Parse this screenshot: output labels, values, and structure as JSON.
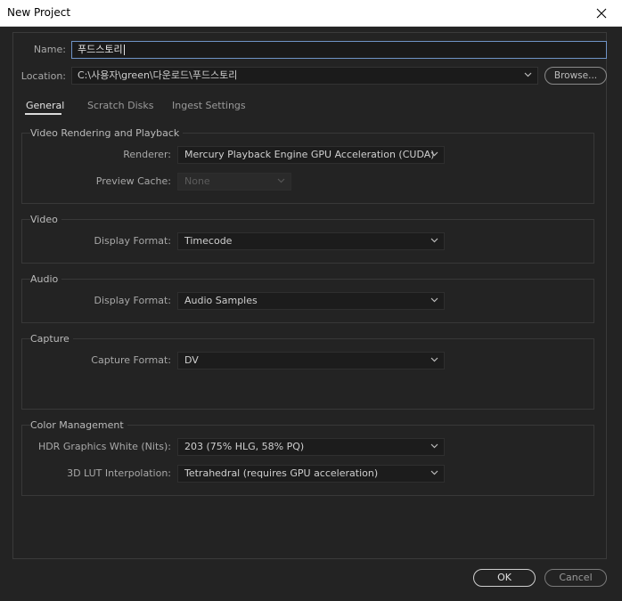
{
  "window": {
    "title": "New Project"
  },
  "name": {
    "label": "Name:",
    "value": "푸드스토리"
  },
  "location": {
    "label": "Location:",
    "value": "C:\\사용자\\green\\다운로드\\푸드스토리",
    "browse_label": "Browse..."
  },
  "tabs": [
    {
      "label": "General",
      "active": true
    },
    {
      "label": "Scratch Disks",
      "active": false
    },
    {
      "label": "Ingest Settings",
      "active": false
    }
  ],
  "video_rendering": {
    "title": "Video Rendering and Playback",
    "renderer_label": "Renderer:",
    "renderer_value": "Mercury Playback Engine GPU Acceleration (CUDA)",
    "preview_cache_label": "Preview Cache:",
    "preview_cache_value": "None"
  },
  "video": {
    "title": "Video",
    "display_format_label": "Display Format:",
    "display_format_value": "Timecode"
  },
  "audio": {
    "title": "Audio",
    "display_format_label": "Display Format:",
    "display_format_value": "Audio Samples"
  },
  "capture": {
    "title": "Capture",
    "capture_format_label": "Capture Format:",
    "capture_format_value": "DV"
  },
  "color_management": {
    "title": "Color Management",
    "hdr_label": "HDR Graphics White (Nits):",
    "hdr_value": "203 (75% HLG, 58% PQ)",
    "lut_label": "3D LUT Interpolation:",
    "lut_value": "Tetrahedral (requires GPU acceleration)"
  },
  "buttons": {
    "ok": "OK",
    "cancel": "Cancel"
  }
}
